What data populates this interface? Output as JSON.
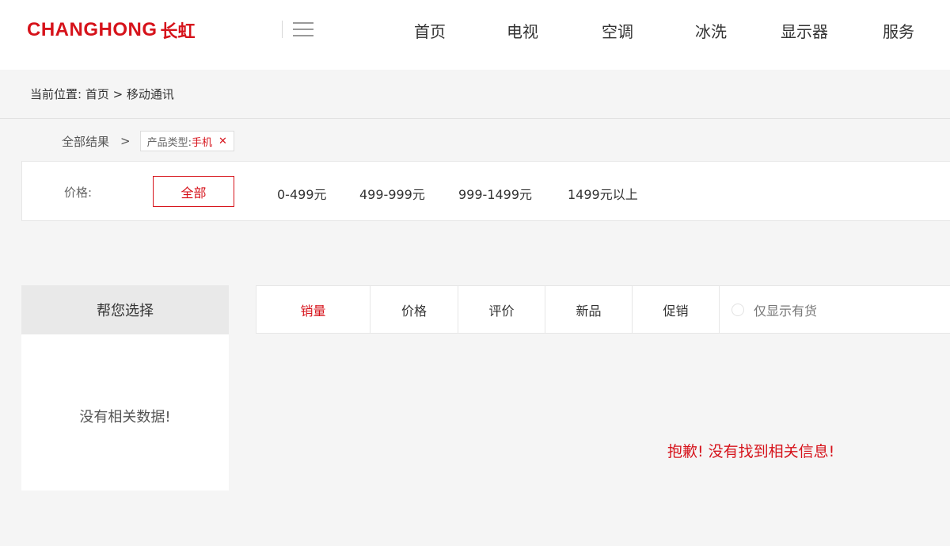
{
  "header": {
    "logo_en": "CHANGHONG",
    "logo_cn": "长虹",
    "nav": [
      "首页",
      "电视",
      "空调",
      "冰洗",
      "显示器",
      "服务"
    ]
  },
  "breadcrumb": "当前位置:  首页 > 移动通讯",
  "filter": {
    "all_results": "全部结果",
    "sep": ">",
    "chip_label": "产品类型: ",
    "chip_value": "手机",
    "chip_close": "✕"
  },
  "price": {
    "label": "价格:",
    "all": "全部",
    "options": [
      "0-499元",
      "499-999元",
      "999-1499元",
      "1499元以上"
    ]
  },
  "sidebar": {
    "title": "帮您选择",
    "empty": "没有相关数据!"
  },
  "sort": {
    "tabs": [
      "销量",
      "价格",
      "评价",
      "新品",
      "促销"
    ],
    "active_index": 0,
    "in_stock_label": "仅显示有货"
  },
  "results_empty": "抱歉! 没有找到相关信息!",
  "colors": {
    "brand": "#d6131b"
  }
}
